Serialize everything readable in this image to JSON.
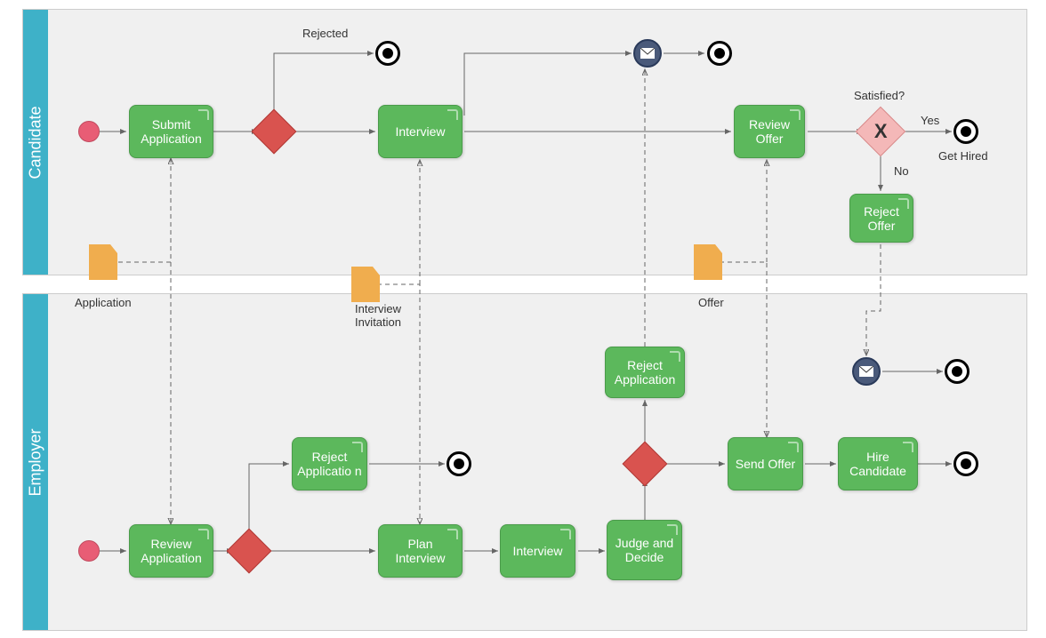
{
  "lanes": {
    "candidate": "Candidate",
    "employer": "Employer"
  },
  "tasks": {
    "submit_application": "Submit Application",
    "interview_c": "Interview",
    "review_offer": "Review Offer",
    "reject_offer": "Reject Offer",
    "review_application": "Review Application",
    "reject_application_e": "Reject Applicatio n",
    "plan_interview": "Plan Interview",
    "interview_e": "Interview",
    "judge_decide": "Judge and Decide",
    "reject_application_e2": "Reject Application",
    "send_offer": "Send Offer",
    "hire_candidate": "Hire Candidate"
  },
  "labels": {
    "rejected": "Rejected",
    "satisfied": "Satisfied?",
    "yes": "Yes",
    "no": "No",
    "get_hired": "Get Hired",
    "application": "Application",
    "interview_invitation": "Interview Invitation",
    "offer": "Offer"
  }
}
